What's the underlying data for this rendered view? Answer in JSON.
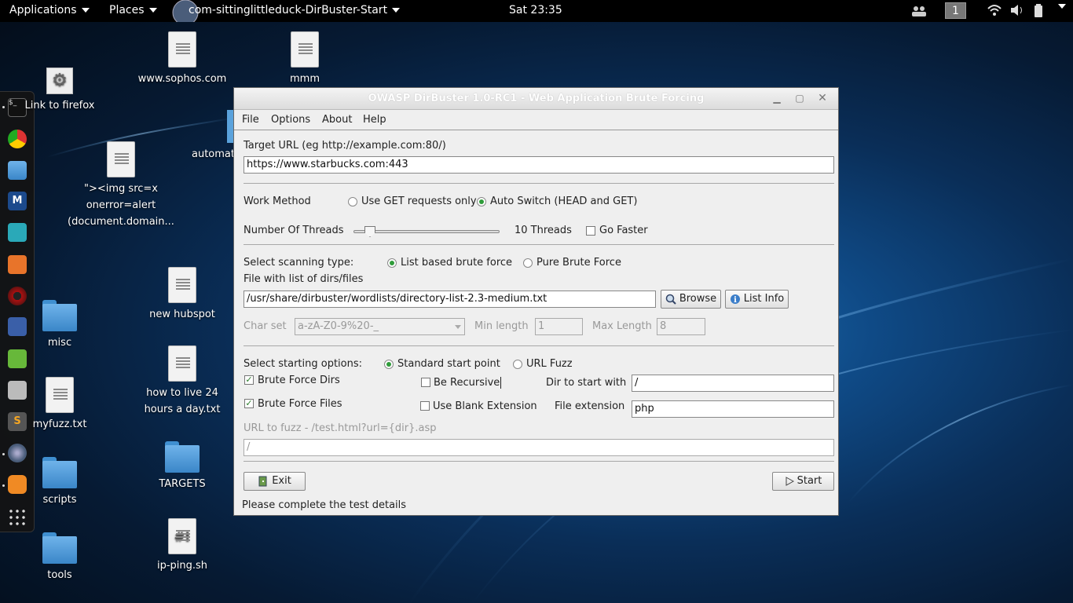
{
  "topbar": {
    "applications": "Applications",
    "places": "Places",
    "active_app": "com-sittinglittleduck-DirBuster-Start",
    "clock": "Sat 23:35",
    "workspace": "1"
  },
  "desktop": {
    "icons": [
      {
        "label": "Link to firefox"
      },
      {
        "label": "www.sophos.com"
      },
      {
        "label": "mmm"
      },
      {
        "label": "automat"
      },
      {
        "label": "\"><img src=x onerror=alert (document.domain..."
      },
      {
        "label": "misc"
      },
      {
        "label": "new hubspot"
      },
      {
        "label": "how to live 24 hours a day.txt"
      },
      {
        "label": "myfuzz.txt"
      },
      {
        "label": "TARGETS"
      },
      {
        "label": "scripts"
      },
      {
        "label": "ip-ping.sh"
      },
      {
        "label": "tools"
      }
    ]
  },
  "window": {
    "title": "OWASP DirBuster 1.0-RC1 - Web Application Brute Forcing",
    "menu": [
      "File",
      "Options",
      "About",
      "Help"
    ],
    "target_url_label": "Target URL (eg http://example.com:80/)",
    "target_url_value": "https://www.starbucks.com:443",
    "work_method_label": "Work Method",
    "work_method_options": [
      "Use GET requests only",
      "Auto Switch (HEAD and GET)"
    ],
    "work_method_selected": "Auto Switch (HEAD and GET)",
    "threads_label": "Number Of Threads",
    "threads_value_text": "10 Threads",
    "threads_fraction": 0.08,
    "go_faster_label": "Go Faster",
    "go_faster_checked": false,
    "scan_type_label": "Select scanning type:",
    "scan_type_options": [
      "List based brute force",
      "Pure Brute Force"
    ],
    "scan_type_selected": "List based brute force",
    "file_list_label": "File with list of dirs/files",
    "file_list_value": "/usr/share/dirbuster/wordlists/directory-list-2.3-medium.txt",
    "browse_label": "Browse",
    "list_info_label": "List Info",
    "charset_label": "Char set",
    "charset_value": "a-zA-Z0-9%20-_",
    "min_length_label": "Min length",
    "min_length_value": "1",
    "max_length_label": "Max Length",
    "max_length_value": "8",
    "start_options_label": "Select starting options:",
    "start_options": [
      "Standard start point",
      "URL Fuzz"
    ],
    "start_option_selected": "Standard start point",
    "brute_force_dirs_label": "Brute Force Dirs",
    "brute_force_dirs_checked": true,
    "be_recursive_label": "Be Recursive",
    "be_recursive_checked": false,
    "dir_start_label": "Dir to start with",
    "dir_start_value": "/",
    "brute_force_files_label": "Brute Force Files",
    "brute_force_files_checked": true,
    "blank_ext_label": "Use Blank Extension",
    "blank_ext_checked": false,
    "file_ext_label": "File extension",
    "file_ext_value": "php",
    "url_fuzz_label": "URL to fuzz - /test.html?url={dir}.asp",
    "url_fuzz_value": "/",
    "exit_label": "Exit",
    "start_label": "Start",
    "status": "Please complete the test details"
  },
  "colors": {
    "radio_selected": "#2f9c3a",
    "desktop_blue": "#1d6fb4"
  }
}
